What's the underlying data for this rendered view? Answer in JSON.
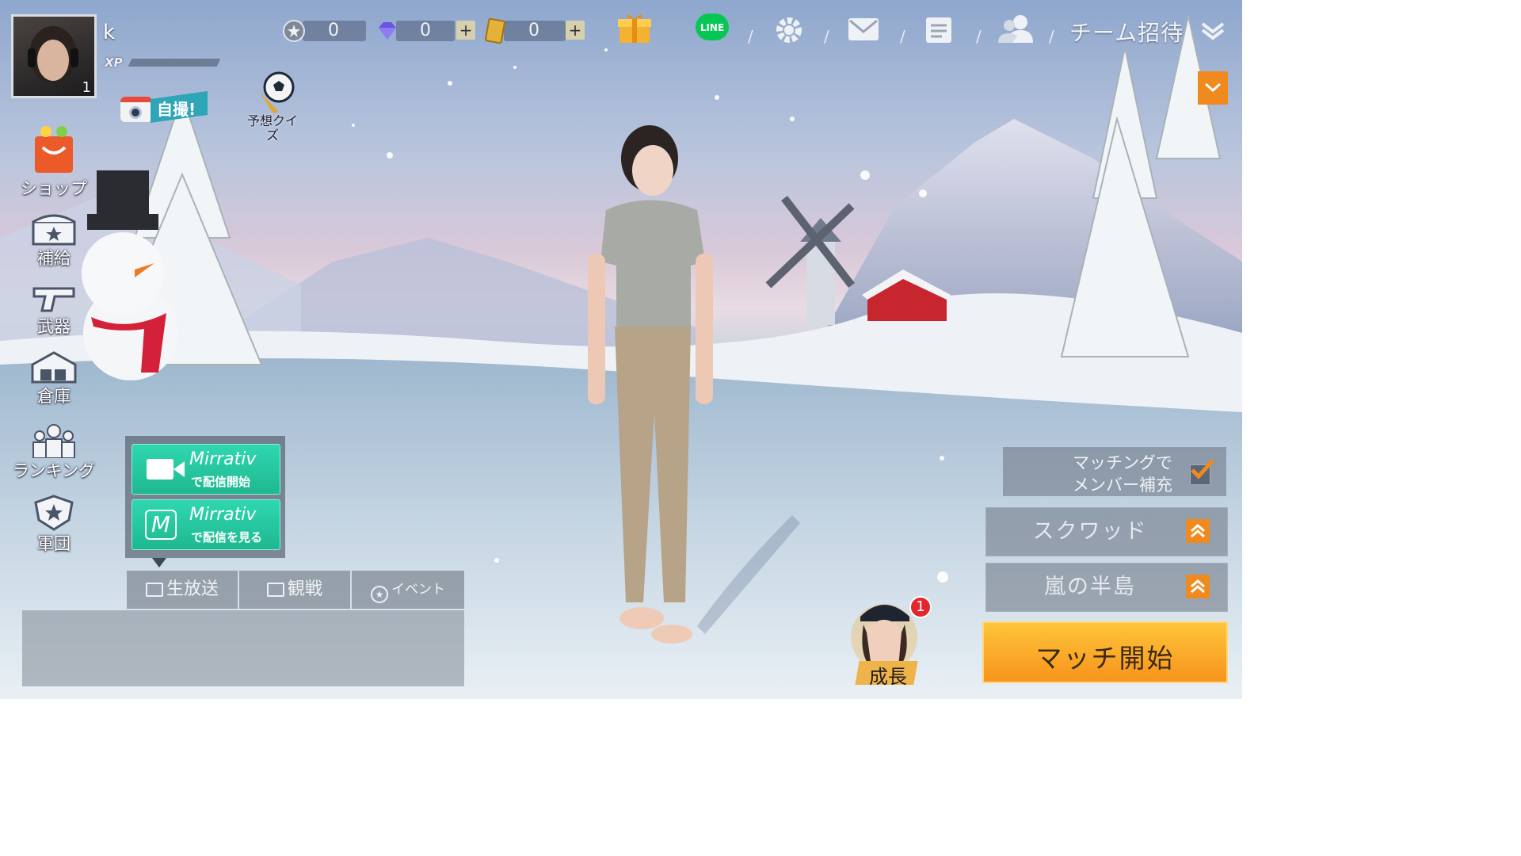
{
  "player": {
    "name": "k",
    "level": "1",
    "xp_label": "XP"
  },
  "currency": {
    "coins": "0",
    "diamonds": "0",
    "vouchers": "0",
    "plus": "+"
  },
  "top_icons": {
    "gift": "gift-icon",
    "line": "LINE",
    "settings": "gear-icon",
    "mail": "mail-icon",
    "notes": "clipboard-icon",
    "friends": "friends-icon"
  },
  "team_invite": {
    "label": "チーム招待"
  },
  "selfie": {
    "label": "自撮!"
  },
  "quiz": {
    "label": "予想クイズ"
  },
  "sidebar": {
    "items": [
      {
        "label": "ショップ",
        "icon": "shop-bag-icon"
      },
      {
        "label": "補給",
        "icon": "supply-chest-icon"
      },
      {
        "label": "武器",
        "icon": "gun-icon"
      },
      {
        "label": "倉庫",
        "icon": "warehouse-icon"
      },
      {
        "label": "ランキング",
        "icon": "ranking-people-icon"
      },
      {
        "label": "軍団",
        "icon": "legion-shield-icon"
      }
    ]
  },
  "mirrativ": {
    "brand": "Mirrativ",
    "start_sub": "で配信開始",
    "watch_sub": "で配信を見る"
  },
  "bottom_tabs": {
    "live": "生放送",
    "watch": "観戦",
    "event": "イベント"
  },
  "match_fill": {
    "line1": "マッチングで",
    "line2": "メンバー補充",
    "checked": true
  },
  "modes": {
    "squad": "スクワッド",
    "map": "嵐の半島"
  },
  "start_match": "マッチ開始",
  "growth": {
    "label": "成長",
    "badge": "1"
  },
  "colors": {
    "accent_orange": "#f08a1e",
    "mirrativ_green": "#24c59d",
    "line_green": "#06c755"
  }
}
